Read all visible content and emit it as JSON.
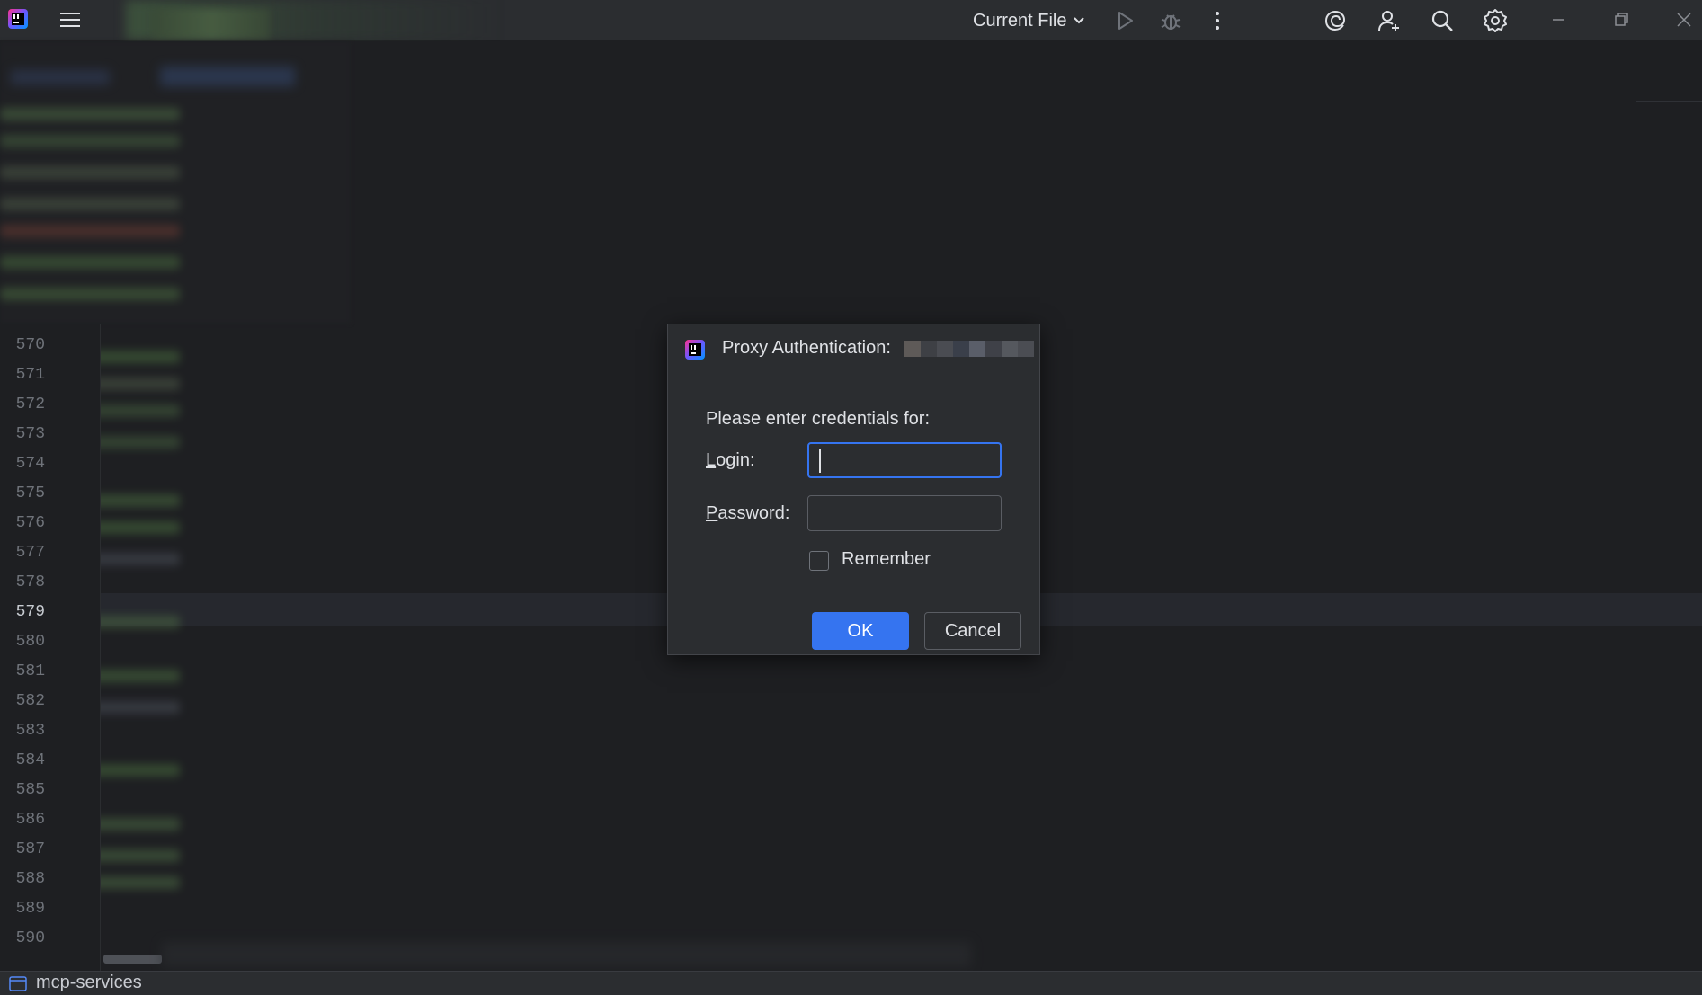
{
  "titlebar": {
    "run_config_label": "Current File",
    "icons": [
      "app-logo-icon",
      "hamburger-menu-icon",
      "chevron-down-icon",
      "run-icon",
      "debug-icon",
      "more-vertical-icon",
      "ai-assistant-icon",
      "add-user-icon",
      "search-icon",
      "settings-gear-icon",
      "minimize-icon",
      "restore-icon",
      "close-icon"
    ]
  },
  "editor": {
    "line_numbers": [
      "570",
      "571",
      "572",
      "573",
      "574",
      "575",
      "576",
      "577",
      "578",
      "579",
      "580",
      "581",
      "582",
      "583",
      "584",
      "585",
      "586",
      "587",
      "588",
      "589",
      "590"
    ],
    "current_line": "579"
  },
  "dialog": {
    "title": "Proxy Authentication:",
    "prompt": "Please enter credentials for:",
    "login_label_mnemonic": "L",
    "login_label_rest": "ogin:",
    "login_value": "",
    "password_label_mnemonic": "P",
    "password_label_rest": "assword:",
    "password_value": "",
    "remember_label": "Remember",
    "remember_checked": false,
    "ok_label": "OK",
    "cancel_label": "Cancel"
  },
  "statusbar": {
    "project_name": "mcp-services"
  },
  "colors": {
    "accent": "#3574f0",
    "background": "#1e1f22",
    "panel": "#2b2d30",
    "text": "#dfe1e5"
  }
}
